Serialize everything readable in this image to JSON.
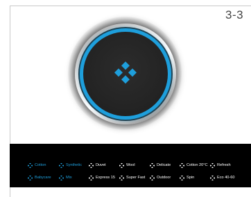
{
  "page_label": "3-3",
  "colors": {
    "accent": "#1e9fdc",
    "panel_background": "#000000",
    "idle_text": "#ffffff"
  },
  "dial": {
    "icon": "four-diamond-icon"
  },
  "programs": [
    {
      "label": "Cotton",
      "active": true
    },
    {
      "label": "Synthetic",
      "active": true
    },
    {
      "label": "Duvet",
      "active": false
    },
    {
      "label": "Wool",
      "active": false
    },
    {
      "label": "Delicate",
      "active": false
    },
    {
      "label": "Cotton 20°C",
      "active": false
    },
    {
      "label": "Refresh",
      "active": false
    },
    {
      "label": "Babycare",
      "active": true
    },
    {
      "label": "Mix",
      "active": true
    },
    {
      "label": "Express 15",
      "active": false
    },
    {
      "label": "Super Fast",
      "active": false
    },
    {
      "label": "Outdoor",
      "active": false
    },
    {
      "label": "Spin",
      "active": false
    },
    {
      "label": "Eco 40-60",
      "active": false
    }
  ]
}
